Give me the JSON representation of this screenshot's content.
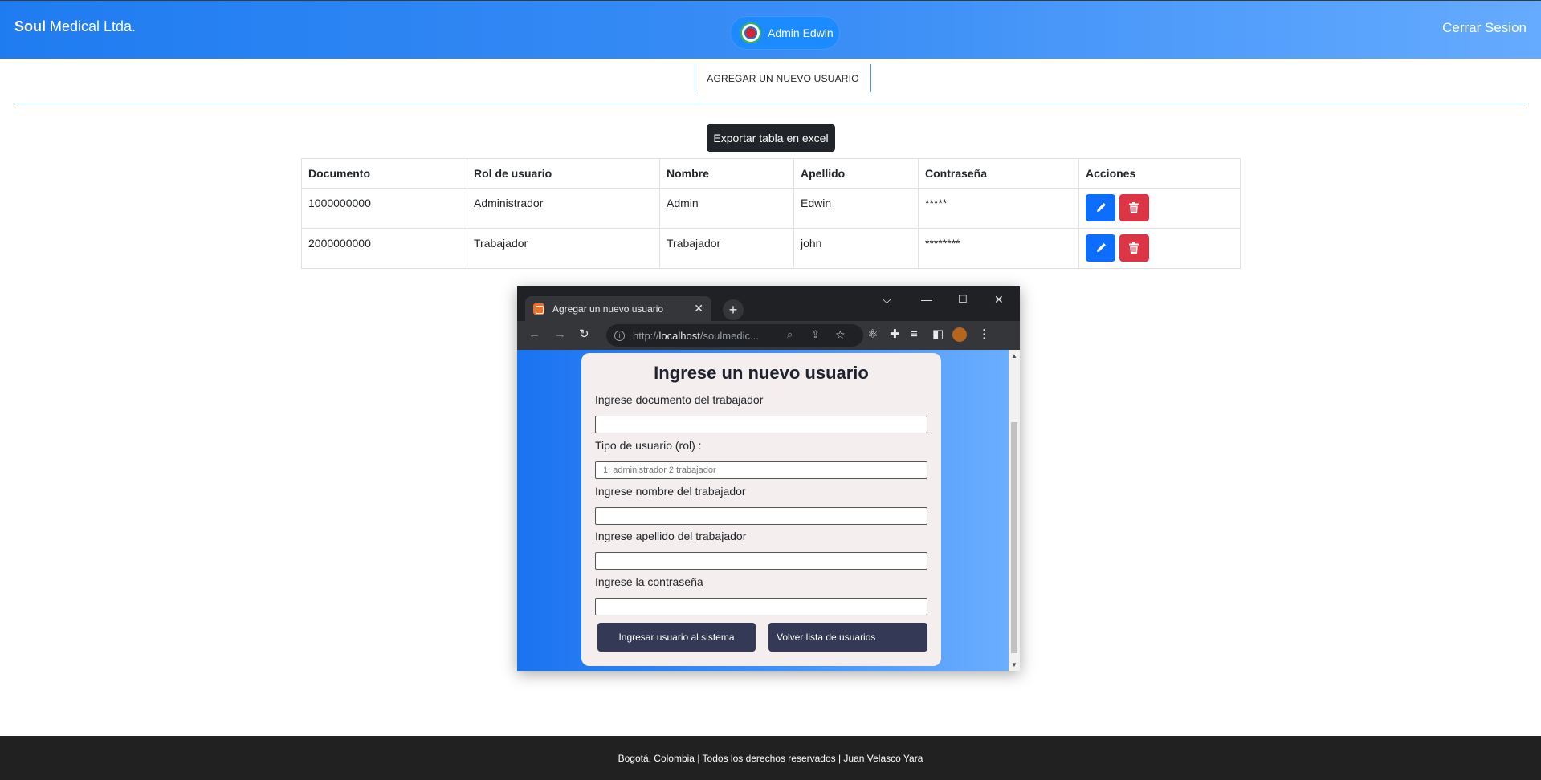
{
  "navbar": {
    "brand_bold": "Soul",
    "brand_rest": " Medical Ltda.",
    "user_label": "Admin Edwin",
    "logout_label": "Cerrar Sesion"
  },
  "subnav": {
    "add_user_label": "AGREGAR UN NUEVO USUARIO"
  },
  "export_label": "Exportar tabla en excel",
  "table": {
    "headers": [
      "Documento",
      "Rol de usuario",
      "Nombre",
      "Apellido",
      "Contraseña",
      "Acciones"
    ],
    "rows": [
      {
        "documento": "1000000000",
        "rol": "Administrador",
        "nombre": "Admin",
        "apellido": "Edwin",
        "contrasena": "*****"
      },
      {
        "documento": "2000000000",
        "rol": "Trabajador",
        "nombre": "Trabajador",
        "apellido": "john",
        "contrasena": "********"
      }
    ]
  },
  "popup": {
    "tab_title": "Agregar un nuevo usuario",
    "url_scheme": "http://",
    "url_host": "localhost",
    "url_path": "/soulmedic...",
    "form": {
      "title": "Ingrese un nuevo usuario",
      "fields": [
        {
          "label": "Ingrese documento del trabajador",
          "value": "",
          "placeholder": ""
        },
        {
          "label": "Tipo de usuario (rol) :",
          "value": "",
          "placeholder": "1: administrador 2:trabajador"
        },
        {
          "label": "Ingrese nombre del trabajador",
          "value": "",
          "placeholder": ""
        },
        {
          "label": "Ingrese apellido del trabajador",
          "value": "",
          "placeholder": ""
        },
        {
          "label": "Ingrese la contraseña",
          "value": "",
          "placeholder": ""
        }
      ],
      "submit_label": "Ingresar usuario al sistema",
      "back_label": "Volver lista de usuarios"
    }
  },
  "footer": {
    "text": "Bogotá, Colombia | Todos los derechos reservados | Juan Velasco Yara"
  },
  "colors": {
    "nav_start": "#1f7cf0",
    "nav_end": "#65abff",
    "edit_button": "#0d6efd",
    "delete_button": "#dc3545",
    "dark_button": "#212529",
    "form_button": "#343a56"
  },
  "icons": {
    "edit": "pencil-icon",
    "delete": "trash-icon",
    "avatar": "wiki-globe-avatar",
    "favicon": "xampp-favicon"
  }
}
